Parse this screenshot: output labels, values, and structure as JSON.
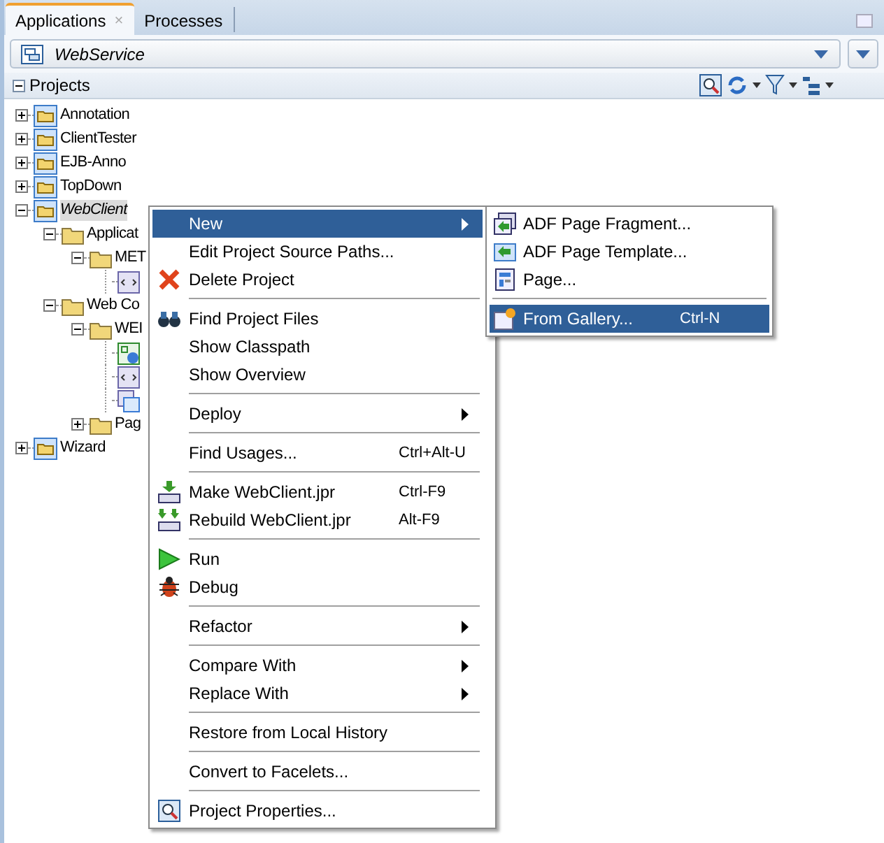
{
  "tabs": [
    {
      "label": "Applications",
      "selected": true,
      "close": "×"
    },
    {
      "label": "Processes",
      "selected": false
    }
  ],
  "app_selector": {
    "value": "WebService"
  },
  "panel": {
    "title": "Projects"
  },
  "tree": [
    {
      "kind": "project",
      "label": "Annotation",
      "expanded": false,
      "selected": false
    },
    {
      "kind": "project",
      "label": "ClientTester",
      "expanded": false,
      "selected": false
    },
    {
      "kind": "project",
      "label": "EJB-Anno",
      "expanded": false,
      "selected": false
    },
    {
      "kind": "project",
      "label": "TopDown",
      "expanded": false,
      "selected": false
    },
    {
      "kind": "project",
      "label": "WebClient",
      "expanded": true,
      "selected": true,
      "children": [
        {
          "kind": "folder",
          "label": "Applicat",
          "expanded": true,
          "children": [
            {
              "kind": "folder",
              "label": "MET",
              "expanded": true,
              "children": [
                {
                  "kind": "file"
                }
              ]
            }
          ]
        },
        {
          "kind": "folder",
          "label": "Web Co",
          "expanded": true,
          "children": [
            {
              "kind": "folder",
              "label": "WEI",
              "expanded": true,
              "children": [
                {
                  "kind": "config"
                },
                {
                  "kind": "file"
                },
                {
                  "kind": "page"
                }
              ]
            },
            {
              "kind": "folder",
              "label": "Pag",
              "expanded": false
            }
          ]
        }
      ]
    },
    {
      "kind": "project",
      "label": "Wizard",
      "expanded": false,
      "selected": false
    }
  ],
  "context_menu": [
    {
      "kind": "item",
      "label": "New",
      "submenu": true,
      "selected": true
    },
    {
      "kind": "item",
      "label": "Edit Project Source Paths...",
      "selected": false
    },
    {
      "kind": "item",
      "label": "Delete Project",
      "selected": false
    },
    {
      "kind": "separator"
    },
    {
      "kind": "item",
      "label": "Find Project Files",
      "selected": false
    },
    {
      "kind": "item",
      "label": "Show Classpath",
      "selected": false
    },
    {
      "kind": "item",
      "label": "Show Overview",
      "selected": false
    },
    {
      "kind": "separator"
    },
    {
      "kind": "item",
      "label": "Deploy",
      "submenu": true,
      "selected": false
    },
    {
      "kind": "separator"
    },
    {
      "kind": "item",
      "label": "Find Usages...",
      "shortcut": "Ctrl+Alt-U",
      "selected": false
    },
    {
      "kind": "separator"
    },
    {
      "kind": "item",
      "label": "Make WebClient.jpr",
      "shortcut": "Ctrl-F9",
      "selected": false
    },
    {
      "kind": "item",
      "label": "Rebuild WebClient.jpr",
      "shortcut": "Alt-F9",
      "selected": false
    },
    {
      "kind": "separator"
    },
    {
      "kind": "item",
      "label": "Run",
      "selected": false
    },
    {
      "kind": "item",
      "label": "Debug",
      "selected": false
    },
    {
      "kind": "separator"
    },
    {
      "kind": "item",
      "label": "Refactor",
      "submenu": true,
      "selected": false
    },
    {
      "kind": "separator"
    },
    {
      "kind": "item",
      "label": "Compare With",
      "submenu": true,
      "selected": false
    },
    {
      "kind": "item",
      "label": "Replace With",
      "submenu": true,
      "selected": false
    },
    {
      "kind": "separator"
    },
    {
      "kind": "item",
      "label": "Restore from Local History",
      "selected": false
    },
    {
      "kind": "separator"
    },
    {
      "kind": "item",
      "label": "Convert to Facelets...",
      "selected": false
    },
    {
      "kind": "separator"
    },
    {
      "kind": "item",
      "label": "Project Properties...",
      "selected": false
    }
  ],
  "submenu": [
    {
      "kind": "item",
      "label": "ADF Page Fragment...",
      "selected": false
    },
    {
      "kind": "item",
      "label": "ADF Page Template...",
      "selected": false
    },
    {
      "kind": "item",
      "label": "Page...",
      "selected": false
    },
    {
      "kind": "separator"
    },
    {
      "kind": "item",
      "label": "From Gallery...",
      "shortcut": "Ctrl-N",
      "selected": true
    }
  ]
}
